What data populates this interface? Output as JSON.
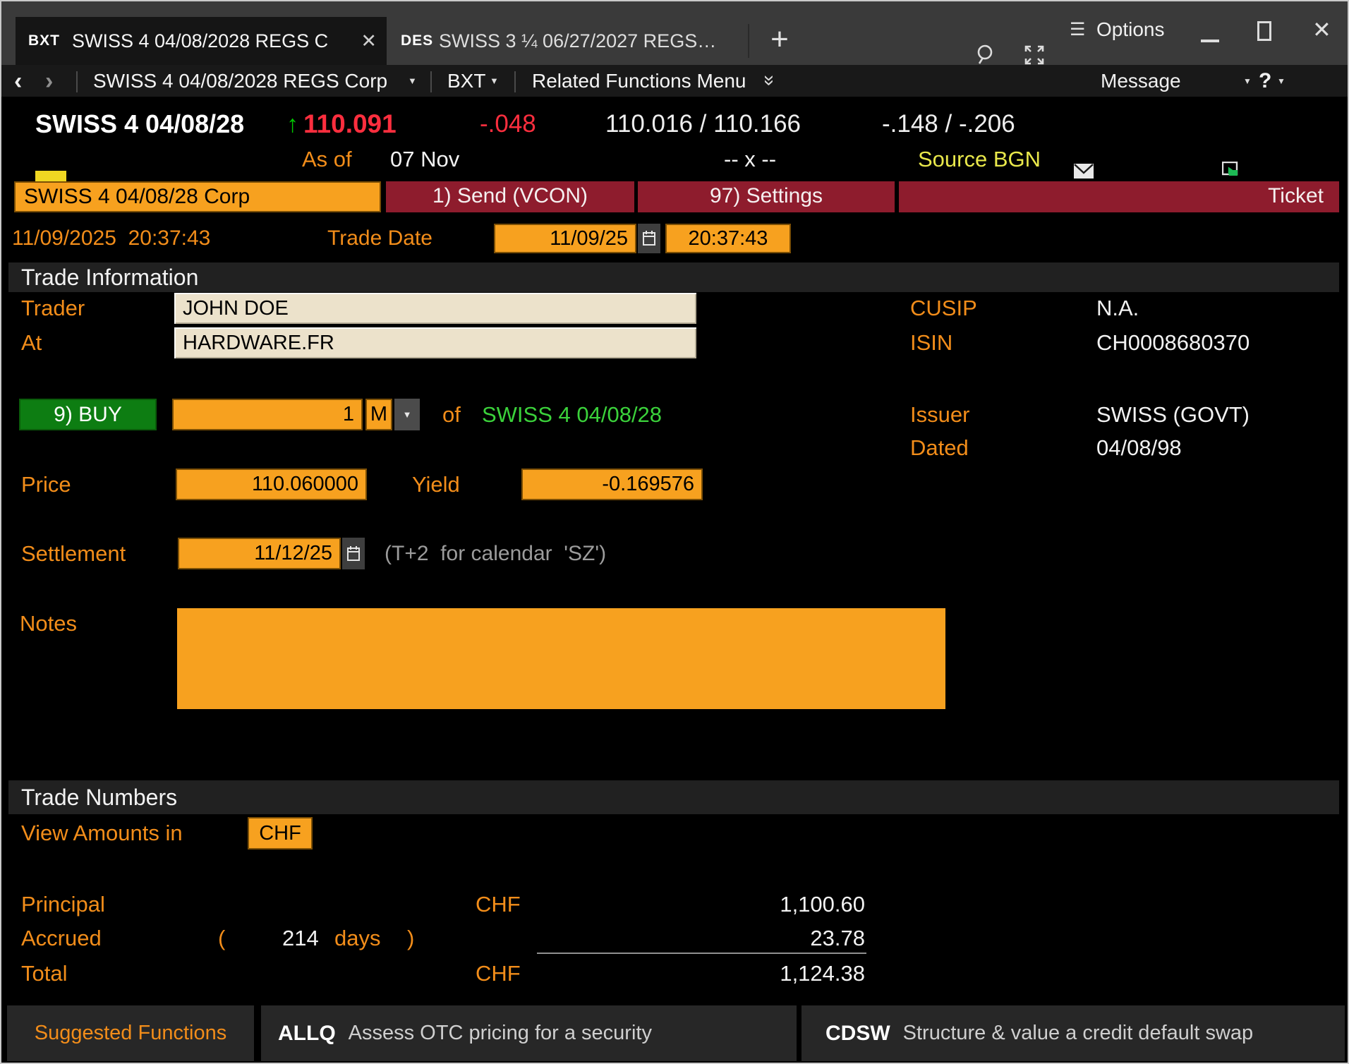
{
  "titlebar": {
    "tabs": [
      {
        "code": "BXT",
        "title": "SWISS 4 04/08/2028 REGS C"
      },
      {
        "code": "DES",
        "title": "SWISS 3 ¼ 06/27/2027 REGS…"
      }
    ],
    "options": "Options"
  },
  "icons": {
    "back": "‹",
    "forward": "›",
    "dropdown": "▼",
    "hamburger": "☰",
    "close": "✕",
    "plus": "+",
    "double_chevron": "»",
    "question": "?"
  },
  "toolbar": {
    "security_menu": "SWISS 4 04/08/2028 REGS Corp",
    "function_code": "BXT",
    "related_menu": "Related Functions Menu",
    "message": "Message"
  },
  "quote": {
    "security": "SWISS 4 04/08/28",
    "arrow": "↑",
    "last": "110.091",
    "change": "-.048",
    "bid_ask": "110.016 / 110.166",
    "yield_change": "-.148 / -.206",
    "as_of_label": "As of",
    "as_of_value": "07 Nov",
    "size": "-- x --",
    "source": "Source BGN"
  },
  "command_bar": {
    "security_button": "SWISS 4 04/08/28 Corp",
    "send_button": "1) Send (VCON)",
    "settings_button": "97) Settings",
    "ticket": "Ticket"
  },
  "trade_date_row": {
    "timestamp": "11/09/2025  20:37:43",
    "label": "Trade Date",
    "date": "11/09/25",
    "time": "20:37:43"
  },
  "trade_information": {
    "title": "Trade Information",
    "trader_label": "Trader",
    "trader": "JOHN DOE",
    "at_label": "At",
    "at": "HARDWARE.FR",
    "cusip_label": "CUSIP",
    "cusip": "N.A.",
    "isin_label": "ISIN",
    "isin": "CH0008680370",
    "buy_button": "9) BUY",
    "amount": "1",
    "unit": "M",
    "of_label": "of",
    "security": "SWISS 4 04/08/28",
    "issuer_label": "Issuer",
    "issuer": "SWISS (GOVT)",
    "dated_label": "Dated",
    "dated": "04/08/98",
    "price_label": "Price",
    "price": "110.060000",
    "yield_label": "Yield",
    "yield": "-0.169576",
    "settlement_label": "Settlement",
    "settlement": "11/12/25",
    "settlement_note": "(T+2  for calendar  'SZ')",
    "notes_label": "Notes"
  },
  "trade_numbers": {
    "title": "Trade Numbers",
    "view_amounts_label": "View Amounts in",
    "currency": "CHF",
    "principal_label": "Principal",
    "principal_ccy": "CHF",
    "principal": "1,100.60",
    "accrued_label": "Accrued",
    "accrued_open": "(",
    "accrued_days": "214",
    "accrued_days_suffix": "days",
    "accrued_close": ")",
    "accrued": "23.78",
    "total_label": "Total",
    "total_ccy": "CHF",
    "total": "1,124.38"
  },
  "footer": {
    "suggested": "Suggested Functions",
    "functions": [
      {
        "code": "ALLQ",
        "desc": "Assess OTC pricing for a security"
      },
      {
        "code": "CDSW",
        "desc": "Structure & value a credit default swap"
      }
    ]
  },
  "colors": {
    "amber": "#f7a11f",
    "label_orange": "#f28d1a",
    "red_button": "#8e1c2d",
    "green_button": "#0d7d12",
    "quote_red": "#fc2e3e",
    "green_text": "#3bd23b",
    "cream": "#ece2cb",
    "yellow": "#e9e84b"
  }
}
